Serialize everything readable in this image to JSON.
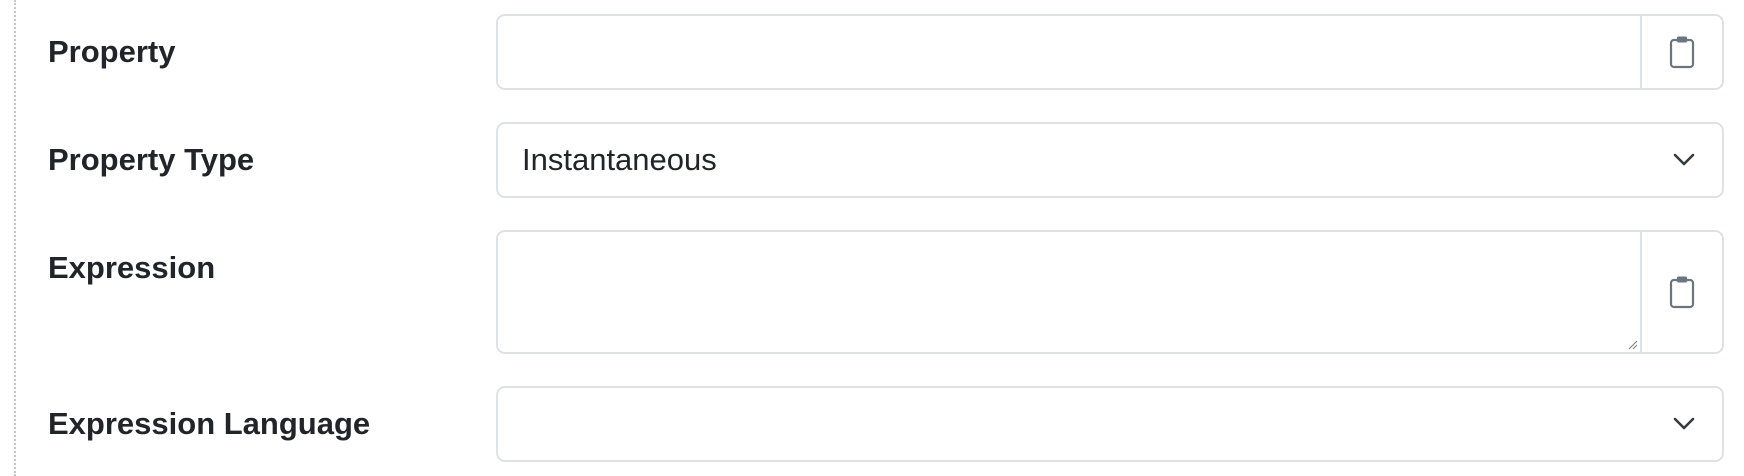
{
  "form": {
    "property": {
      "label": "Property",
      "value": ""
    },
    "property_type": {
      "label": "Property Type",
      "selected": "Instantaneous"
    },
    "expression": {
      "label": "Expression",
      "value": ""
    },
    "expression_language": {
      "label": "Expression Language",
      "selected": ""
    }
  },
  "icons": {
    "paste": "clipboard-icon",
    "dropdown": "chevron-down-icon"
  },
  "colors": {
    "border": "#dee2e6",
    "text": "#212529",
    "icon": "#6c757d"
  }
}
